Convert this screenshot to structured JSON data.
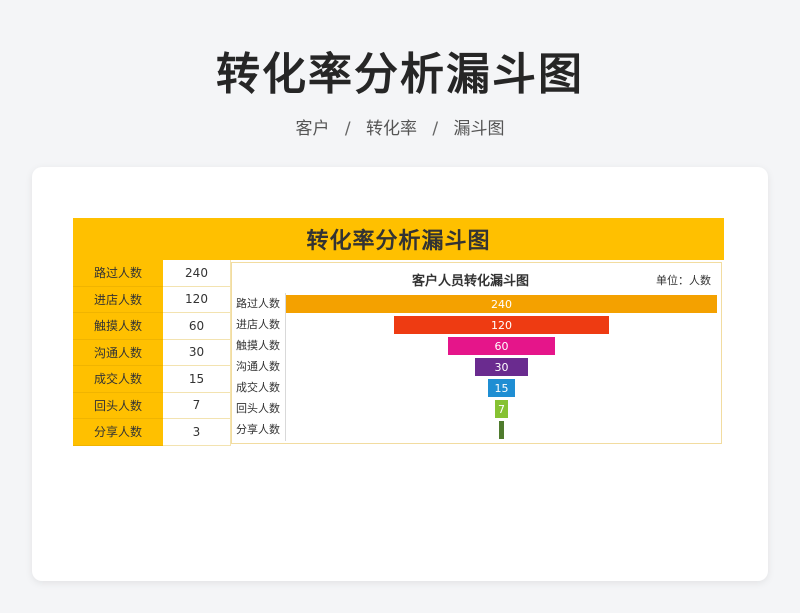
{
  "page": {
    "title": "转化率分析漏斗图",
    "breadcrumb": [
      "客户",
      "转化率",
      "漏斗图"
    ],
    "breadcrumb_separator": "/"
  },
  "sheet": {
    "title": "转化率分析漏斗图",
    "rows": [
      {
        "label": "路过人数",
        "value": "240"
      },
      {
        "label": "进店人数",
        "value": "120"
      },
      {
        "label": "触摸人数",
        "value": "60"
      },
      {
        "label": "沟通人数",
        "value": "30"
      },
      {
        "label": "成交人数",
        "value": "15"
      },
      {
        "label": "回头人数",
        "value": "7"
      },
      {
        "label": "分享人数",
        "value": "3"
      }
    ]
  },
  "chart_data": {
    "type": "bar",
    "subtype": "funnel",
    "title": "客户人员转化漏斗图",
    "unit_label": "单位：人数",
    "categories": [
      "路过人数",
      "进店人数",
      "触摸人数",
      "沟通人数",
      "成交人数",
      "回头人数",
      "分享人数"
    ],
    "values": [
      240,
      120,
      60,
      30,
      15,
      7,
      3
    ],
    "data_labels": [
      "240",
      "120",
      "60",
      "30",
      "15",
      "7",
      ""
    ],
    "colors": [
      "#f4a100",
      "#ee3b12",
      "#e5158a",
      "#6a2b8f",
      "#1f8ed3",
      "#86c232",
      "#4f7b2e"
    ],
    "legend": "none",
    "grid": false
  },
  "colors": {
    "accent": "#ffc000",
    "background": "#f4f5f7",
    "card": "#ffffff"
  }
}
